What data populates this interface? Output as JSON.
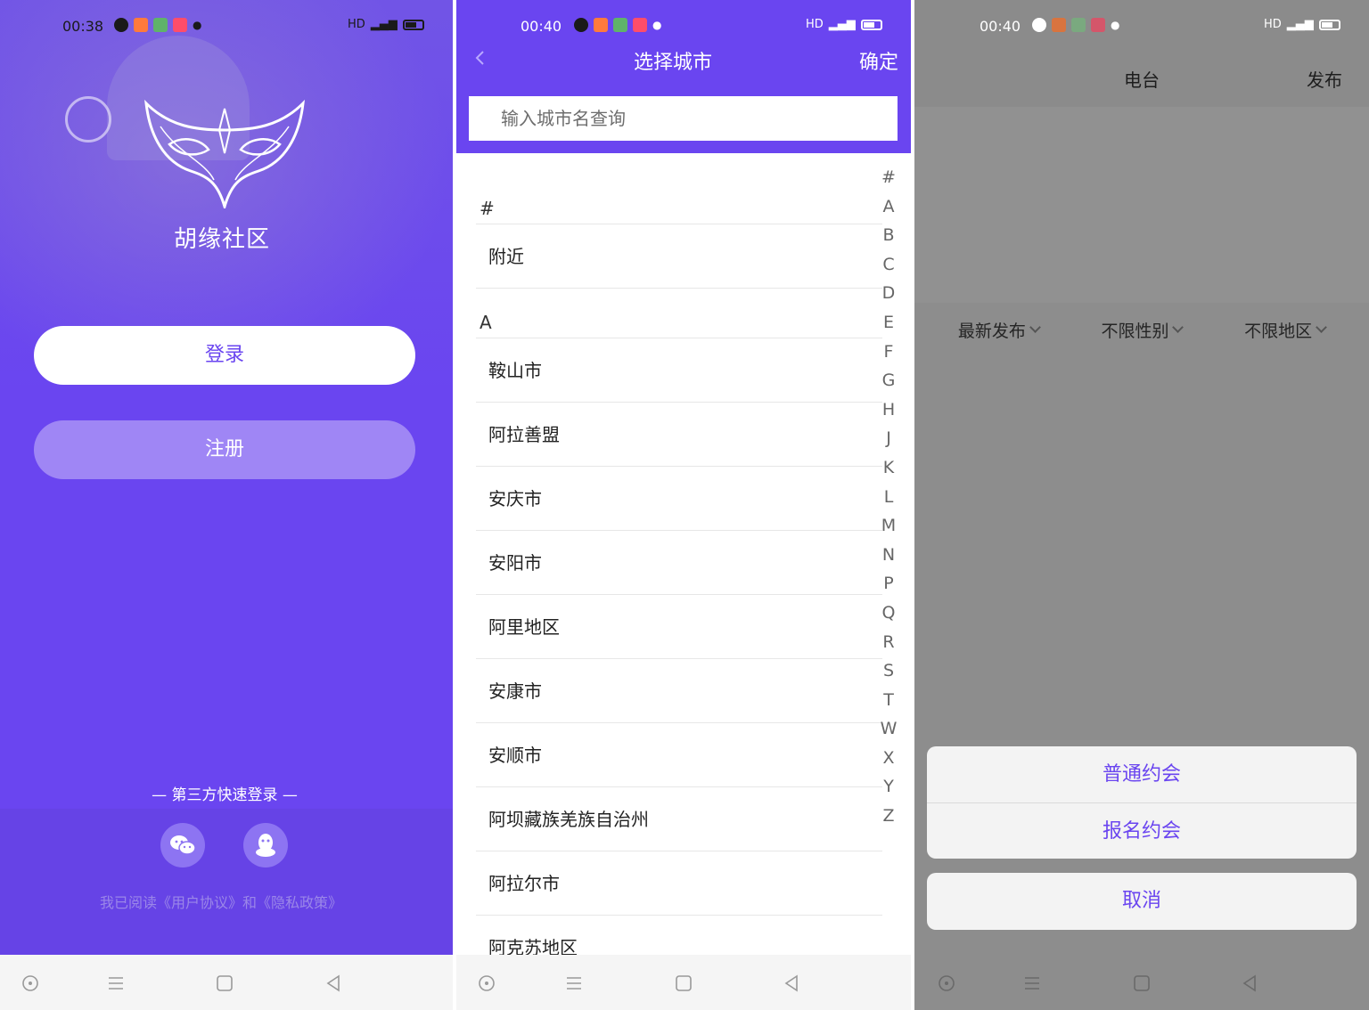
{
  "screen_login": {
    "status": {
      "time": "00:38",
      "signal": "HD"
    },
    "app_name": "胡缘社区",
    "login_label": "登录",
    "register_label": "注册",
    "third_party_label": "— 第三方快速登录 —",
    "agreement_text": "我已阅读《用户协议》和《隐私政策》",
    "sns_icons": [
      "wechat-icon",
      "qq-icon"
    ],
    "colors": {
      "primary": "#6a45f0",
      "register_button": "#9f86f5"
    }
  },
  "screen_city": {
    "status": {
      "time": "00:40",
      "signal": "HD"
    },
    "title": "选择城市",
    "confirm_label": "确定",
    "search_placeholder": "输入城市名查询",
    "sections": [
      {
        "header": "#",
        "items": [
          "附近"
        ]
      },
      {
        "header": "A",
        "items": [
          "鞍山市",
          "阿拉善盟",
          "安庆市",
          "安阳市",
          "阿里地区",
          "安康市",
          "安顺市",
          "阿坝藏族羌族自治州",
          "阿拉尔市",
          "阿克苏地区"
        ]
      }
    ],
    "index_letters": [
      "#",
      "A",
      "B",
      "C",
      "D",
      "E",
      "F",
      "G",
      "H",
      "J",
      "K",
      "L",
      "M",
      "N",
      "P",
      "Q",
      "R",
      "S",
      "T",
      "W",
      "X",
      "Y",
      "Z"
    ]
  },
  "screen_radio": {
    "status": {
      "time": "00:40",
      "signal": "HD"
    },
    "title": "电台",
    "publish_label": "发布",
    "filters": [
      "最新发布",
      "不限性别",
      "不限地区"
    ],
    "action_sheet": {
      "options": [
        "普通约会",
        "报名约会"
      ],
      "cancel_label": "取消"
    }
  }
}
